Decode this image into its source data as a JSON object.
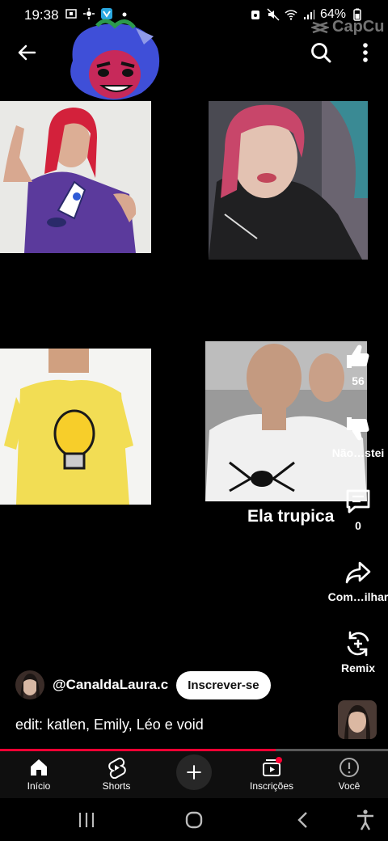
{
  "status_bar": {
    "time": "19:38",
    "battery": "64%",
    "left_icons": [
      "screenshot-icon",
      "weather-icon",
      "app-notification-icon",
      "dot-icon"
    ],
    "right_icons": [
      "alarm-icon",
      "mute-icon",
      "wifi-icon",
      "signal-icon",
      "battery-icon"
    ]
  },
  "watermark": {
    "text": "CapCu"
  },
  "top_bar": {
    "icons": [
      "back-arrow-icon",
      "search-icon",
      "more-vert-icon"
    ]
  },
  "video": {
    "caption_overlay": "Ela trupica",
    "photos": [
      "photo-girl-purple-rocket-shirt",
      "photo-girl-selfie",
      "photo-boy-yellow-bulb-shirt",
      "photo-boy-spider-shirt"
    ]
  },
  "actions": {
    "like_count": "56",
    "dislike_label": "Não…stei",
    "comment_count": "0",
    "share_label": "Com…ilhar",
    "remix_label": "Remix"
  },
  "channel": {
    "handle": "@CanaldaLaura.c",
    "subscribe_label": "Inscrever-se",
    "description": "edit: katlen, Emily, Léo e void"
  },
  "progress": {
    "fraction": 0.71,
    "color": "#ff0033"
  },
  "bottom_nav": {
    "home": "Início",
    "shorts": "Shorts",
    "subscriptions": "Inscrições",
    "you": "Você"
  },
  "colors": {
    "accent": "#ff0033",
    "background": "#000000",
    "nav_bg": "#0f0f0f"
  }
}
